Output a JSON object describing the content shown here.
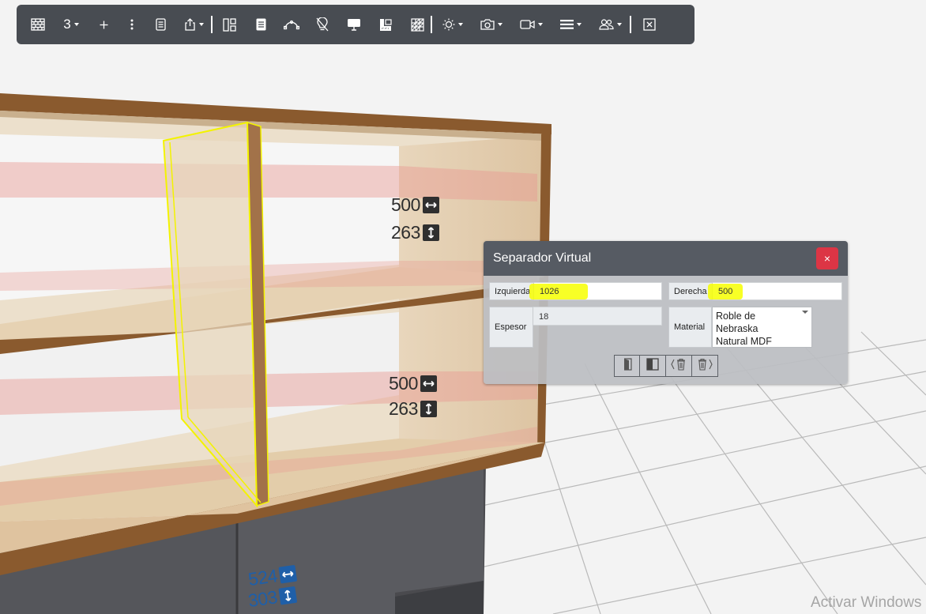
{
  "toolbar": {
    "view_count": "3",
    "items": [
      {
        "icon": "brick-wall-icon"
      },
      {
        "icon": "plus-icon"
      },
      {
        "icon": "vertical-dots-icon"
      },
      {
        "icon": "document-icon"
      },
      {
        "icon": "share-export-icon"
      },
      {
        "icon": "layout-icon"
      },
      {
        "icon": "page-icon"
      },
      {
        "icon": "bezier-curve-icon"
      },
      {
        "icon": "lightbulb-off-icon"
      },
      {
        "icon": "monitor-icon"
      },
      {
        "icon": "ruler-icon"
      },
      {
        "icon": "grid-pattern-icon"
      },
      {
        "icon": "sun-icon"
      },
      {
        "icon": "camera-icon"
      },
      {
        "icon": "video-camera-icon"
      },
      {
        "icon": "list-lines-icon"
      },
      {
        "icon": "users-icon"
      },
      {
        "icon": "close-square-icon"
      }
    ]
  },
  "dimensions": {
    "upper": {
      "width": "500",
      "height": "263"
    },
    "lower": {
      "width": "500",
      "height": "263"
    },
    "base": {
      "width": "524",
      "height": "303"
    }
  },
  "dialog": {
    "title": "Separador Virtual",
    "close_label": "×",
    "left_label": "Izquierda",
    "left_value": "1026",
    "right_label": "Derecha",
    "right_value": "500",
    "thickness_label": "Espesor",
    "thickness_value": "18",
    "material_label": "Material",
    "material_value": "Roble de Nebraska Natural MDF",
    "material_lines": [
      "Roble de",
      "Nebraska",
      "Natural MDF"
    ],
    "action_icons": [
      "door-left-icon",
      "panel-half-icon",
      "delete-left-icon",
      "delete-right-icon"
    ]
  },
  "watermark": "Activar Windows",
  "colors": {
    "toolbar_bg": "#484c52",
    "dialog_header": "#565b63",
    "close_red": "#dc3545",
    "highlight": "#f7ff00",
    "wood": "#e6d3b8",
    "edge": "#8a5a2e",
    "selection": "#f3f300"
  }
}
